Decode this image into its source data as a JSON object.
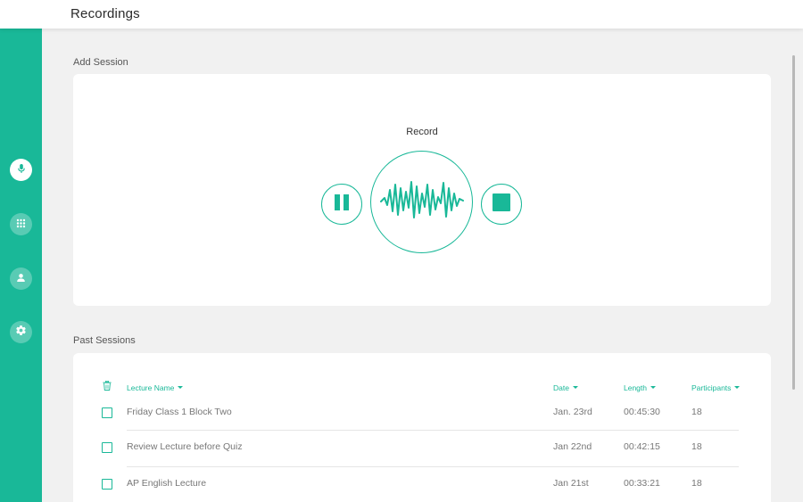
{
  "header": {
    "title": "Recordings"
  },
  "sidebar": {
    "items": [
      {
        "icon": "microphone-icon",
        "active": true
      },
      {
        "icon": "grid-icon",
        "active": false
      },
      {
        "icon": "user-icon",
        "active": false
      },
      {
        "icon": "gear-icon",
        "active": false
      }
    ]
  },
  "add_session": {
    "label": "Add Session",
    "record_label": "Record",
    "controls": [
      "pause-icon",
      "waveform-icon",
      "stop-icon"
    ]
  },
  "past_sessions": {
    "label": "Past Sessions",
    "columns": {
      "name": "Lecture Name",
      "date": "Date",
      "length": "Length",
      "participants": "Participants"
    },
    "rows": [
      {
        "name": "Friday Class 1 Block Two",
        "date": "Jan. 23rd",
        "length": "00:45:30",
        "participants": "18"
      },
      {
        "name": "Review Lecture before Quiz",
        "date": "Jan 22nd",
        "length": "00:42:15",
        "participants": "18"
      },
      {
        "name": "AP English Lecture",
        "date": "Jan 21st",
        "length": "00:33:21",
        "participants": "18"
      }
    ]
  },
  "colors": {
    "accent": "#19b898",
    "background": "#f1f1f1",
    "card": "#ffffff"
  }
}
